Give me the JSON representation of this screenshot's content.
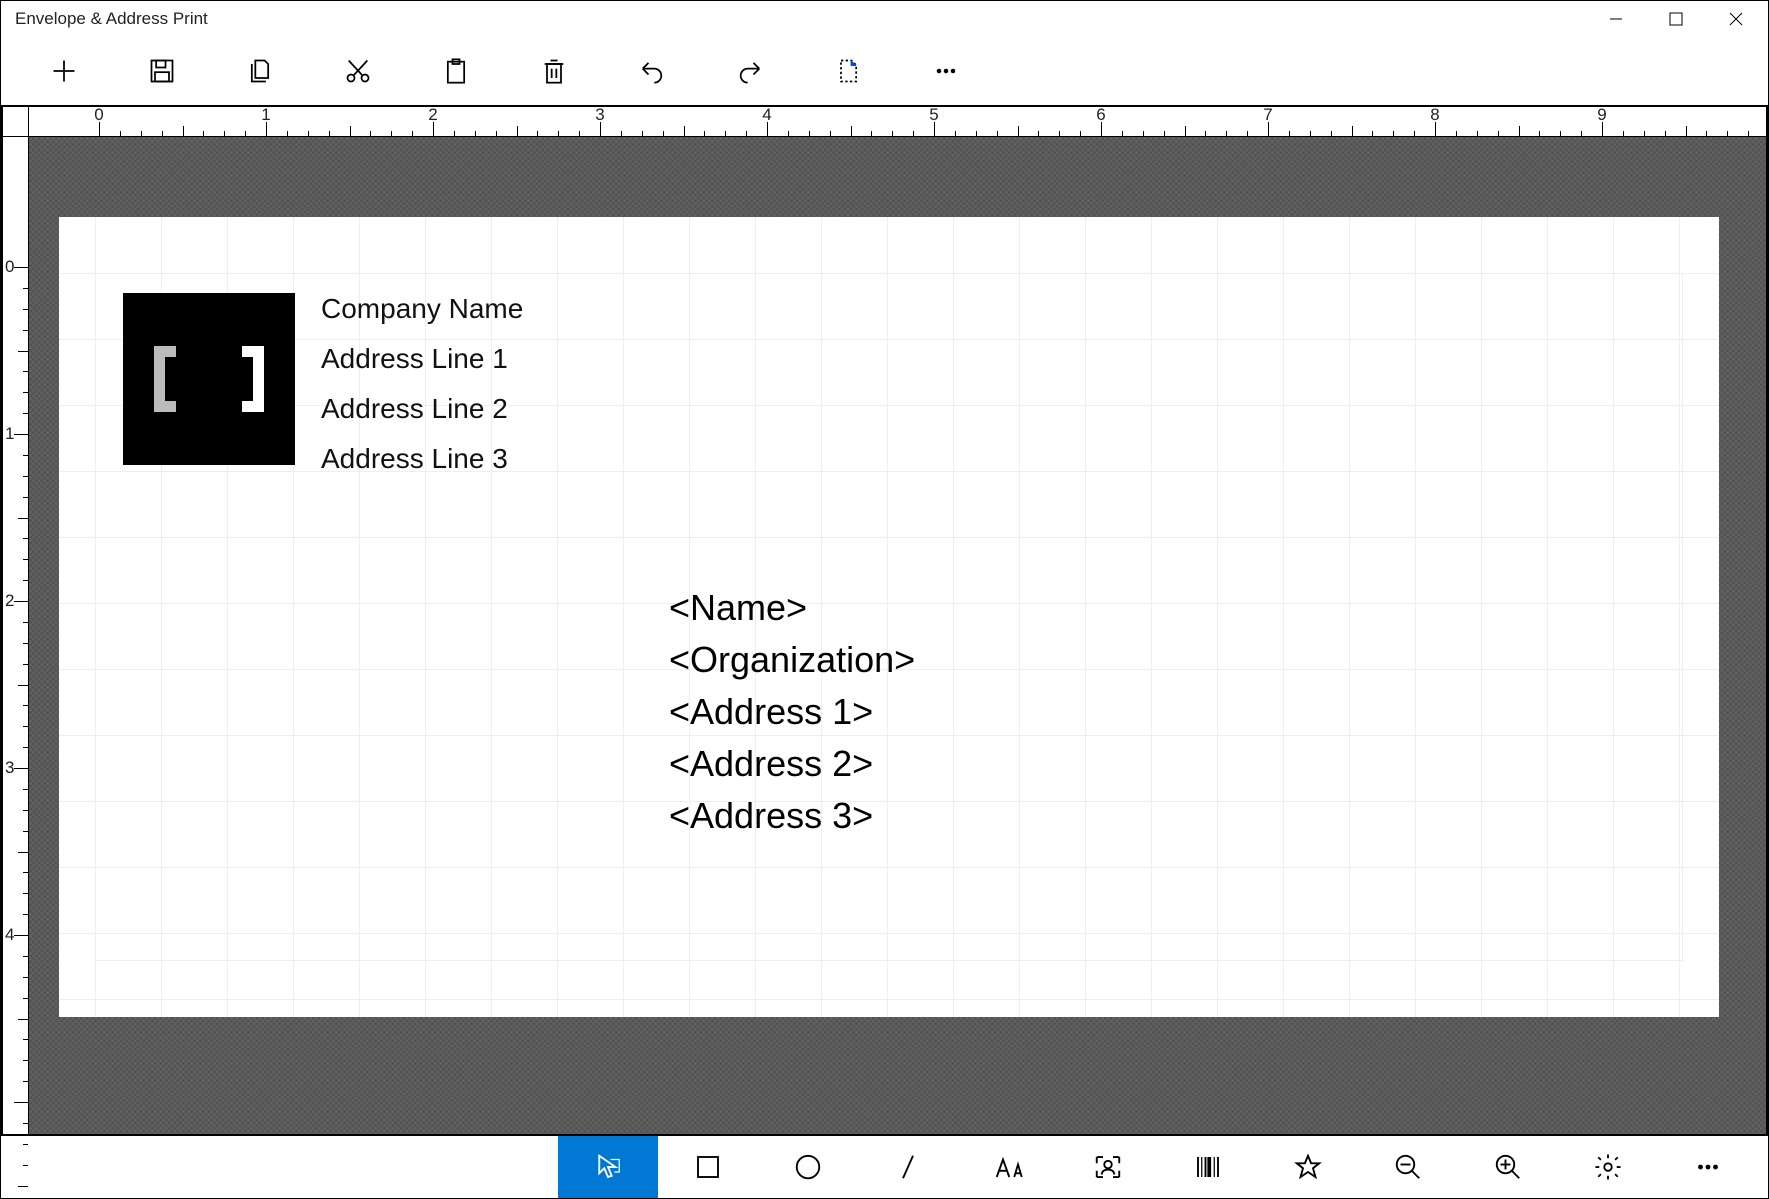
{
  "window": {
    "title": "Envelope & Address Print"
  },
  "toolbar": {
    "items": [
      {
        "name": "new-icon"
      },
      {
        "name": "save-icon"
      },
      {
        "name": "copy-icon"
      },
      {
        "name": "cut-icon"
      },
      {
        "name": "paste-icon"
      },
      {
        "name": "delete-icon"
      },
      {
        "name": "undo-icon"
      },
      {
        "name": "redo-icon"
      },
      {
        "name": "new-page-icon"
      },
      {
        "name": "more-icon"
      }
    ]
  },
  "ruler": {
    "h_labels": [
      "0",
      "1",
      "2",
      "3",
      "4",
      "5",
      "6",
      "7",
      "8",
      "9"
    ],
    "v_labels": [
      "0",
      "1",
      "2",
      "3",
      "4"
    ]
  },
  "envelope": {
    "sender": {
      "company": "Company Name",
      "addr1": "Address Line 1",
      "addr2": "Address Line 2",
      "addr3": "Address Line 3"
    },
    "recipient": {
      "name": "<Name>",
      "org": "<Organization>",
      "addr1": "<Address 1>",
      "addr2": "<Address 2>",
      "addr3": "<Address 3>"
    }
  },
  "bottombar": {
    "items": [
      {
        "name": "select-tool-icon",
        "active": true
      },
      {
        "name": "rectangle-tool-icon"
      },
      {
        "name": "circle-tool-icon"
      },
      {
        "name": "line-tool-icon"
      },
      {
        "name": "text-tool-icon"
      },
      {
        "name": "person-tool-icon"
      },
      {
        "name": "barcode-tool-icon"
      },
      {
        "name": "star-tool-icon"
      },
      {
        "name": "zoom-out-icon"
      },
      {
        "name": "zoom-in-icon"
      },
      {
        "name": "settings-icon"
      },
      {
        "name": "more-icon"
      }
    ]
  }
}
